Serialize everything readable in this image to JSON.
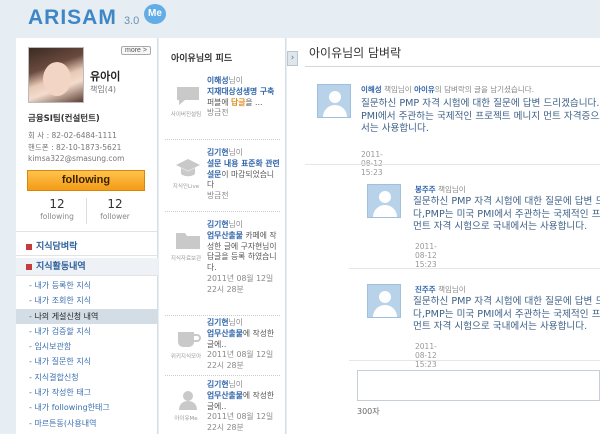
{
  "brand": {
    "logo": "ARISAM",
    "version": "3.0",
    "badge": "Me"
  },
  "profile": {
    "more": "more >",
    "name": "유아이",
    "rank": "책임(4)",
    "org": "금융SI팀(컨설턴트)",
    "company_phone": "회 사 : 82-02-6484-1111",
    "mobile_phone": "핸드폰 : 82-10-1873-5621",
    "email": "kimsa322@smasung.com",
    "following_button": "following",
    "following_count": "12",
    "following_label": "following",
    "follower_count": "12",
    "follower_label": "follower"
  },
  "nav": {
    "section1": "지식담벼락",
    "section2": "지식활동내역",
    "items": [
      "내가 등록한 지식",
      "내가 조회한 지식",
      "나의 게설신청 내역",
      "내가 검증할 지식",
      "임시보관함",
      "내가 질문한 지식",
      "지식결합신청",
      "내가 작성한 태그",
      "내가 following한태그",
      "마르튼동(사용내역"
    ],
    "active_index": 2
  },
  "feed": {
    "title": "아이유님의 피드",
    "items": [
      {
        "icon": "chat-bubble-icon",
        "caption": "사이버진설팀",
        "who": "이해성",
        "suffix": "님이",
        "subject": "지재대상성생명 구축",
        "tail": "퍼블에",
        "highlight": "답글",
        "tail2": "을 ...",
        "time": "방금전"
      },
      {
        "icon": "graduation-cap-icon",
        "caption": "지식인Live",
        "who": "김기현",
        "suffix": "님이",
        "subject": "설문 내용 표준화 관련 설문",
        "tail": "이 마감되었습니다",
        "highlight": "",
        "tail2": "",
        "time": "방금전"
      },
      {
        "icon": "folder-icon",
        "caption": "지식자료보관",
        "who": "김기현",
        "suffix": "님이",
        "subject": "업무산출물",
        "tail": "카페에 작성한 글에 구자현님이 답글을 등록 하였습니다.",
        "highlight": "",
        "tail2": "",
        "time": "2011년 08월 12일 22시 28분"
      },
      {
        "icon": "coffee-cup-icon",
        "caption": "위키지식모아",
        "who": "김기현",
        "suffix": "님이",
        "subject": "업무산출물",
        "tail": "에 작성한 글에..",
        "highlight": "",
        "tail2": "",
        "time": "2011년 08월 12일 22시 28분"
      },
      {
        "icon": "person-icon",
        "caption": "아이유Me",
        "who": "김기현",
        "suffix": "님이",
        "subject": "업무산출물",
        "tail": "에 작성한 글에..",
        "highlight": "",
        "tail2": "",
        "time": "2011년 08월 12일 22시 28분"
      }
    ]
  },
  "main": {
    "title": "아이유님의 담벼락",
    "posts": [
      {
        "author": "이해성",
        "meta_mid": " 책임님이 ",
        "target": "아이유",
        "meta_tail": "의 담벼락의 글을 남기셨습니다.",
        "lines": [
          "질문하신 PMP 자격 시험에 대한 질문에 답변 드리겠습니다.",
          "PMI에서 주관하는 국제적인 프로젝트 메니지 먼트 자격증으로",
          "서는 사용합니다."
        ],
        "date": "2011-08-12 15:23"
      },
      {
        "author": "봉주주",
        "meta_tail": " 책임님이",
        "lines": [
          "질문하신 PMP 자격 시험에 대한 질문에 답변 드리겠습니다.",
          "다,PMP는 미국 PMI에서 주관하는 국제적인 프로젝트",
          "먼트 자격 시험으로 국내에서는 사용합니다."
        ],
        "date": "2011-08-12 15:23"
      },
      {
        "author": "진주주",
        "meta_tail": " 책임님이",
        "lines": [
          "질문하신 PMP 자격 시험에 대한 질문에 답변 드리겠습니다.",
          "다,PMP는 미국 PMI에서 주관하는 국제적인 프로젝트",
          "먼트 자격 시험으로 국내에서는 사용합니다."
        ],
        "date": "2011-08-12 15:23"
      }
    ],
    "counter": "300자"
  }
}
